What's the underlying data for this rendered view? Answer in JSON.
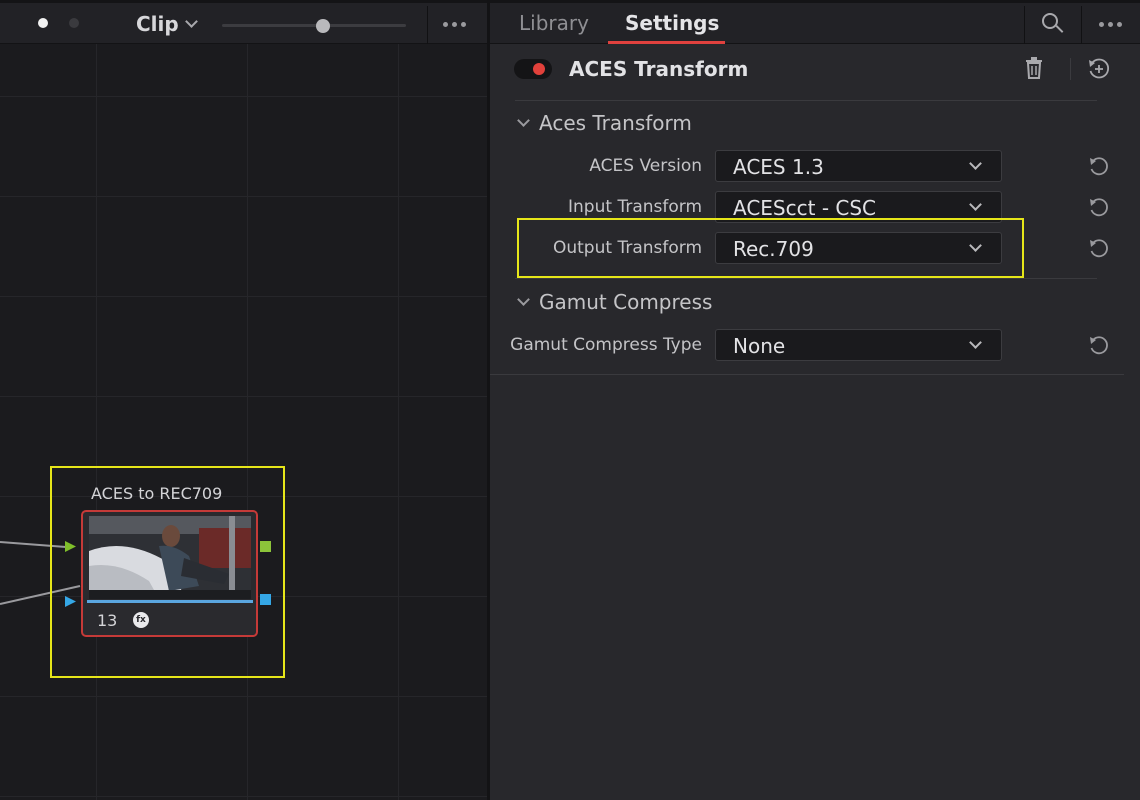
{
  "node_editor": {
    "clip_selector_label": "Clip",
    "zoom_level": 0.55,
    "node": {
      "label": "ACES to REC709",
      "number": "13",
      "fx_badge": "fx"
    }
  },
  "inspector": {
    "tabs": [
      {
        "label": "Library",
        "active": false
      },
      {
        "label": "Settings",
        "active": true
      }
    ],
    "effect": {
      "title": "ACES Transform",
      "enabled": true
    },
    "sections": [
      {
        "title": "Aces Transform",
        "expanded": true,
        "rows": [
          {
            "label": "ACES Version",
            "value": "ACES 1.3"
          },
          {
            "label": "Input Transform",
            "value": "ACEScct - CSC"
          },
          {
            "label": "Output Transform",
            "value": "Rec.709"
          }
        ]
      },
      {
        "title": "Gamut Compress",
        "expanded": true,
        "rows": [
          {
            "label": "Gamut Compress Type",
            "value": "None"
          }
        ]
      }
    ]
  },
  "icons": [
    "more-icon",
    "search-icon",
    "trash-icon",
    "add-keyframe-icon",
    "reset-icon",
    "chevron-down-icon",
    "fx-icon"
  ],
  "colors": {
    "accent_red": "#e0413e",
    "highlight_yellow": "#e6e619",
    "node_border": "#c53a38",
    "input_port_green": "#7fbf2a",
    "output_port_green": "#8cc43a",
    "port_blue": "#35a7e6"
  }
}
